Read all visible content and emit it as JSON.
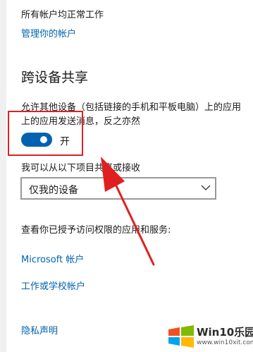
{
  "status": {
    "text": "所有帐户均正常工作",
    "manage_link": "管理你的帐户"
  },
  "cross_device": {
    "title": "跨设备共享",
    "description_line1": "允许其他设备（包括链接的手机和平板电脑）上的应用",
    "description_line2": "上的应用发送消息，反之亦然",
    "toggle_state": "on",
    "toggle_label": "开",
    "share_label": "我可以从以下项目共享或接收",
    "dropdown_value": "仅我的设备"
  },
  "access": {
    "text": "查看你已授予访问权限的应用和服务:",
    "microsoft_link": "Microsoft 帐户",
    "work_link": "工作或学校帐户"
  },
  "footer": {
    "privacy_link": "隐私声明"
  },
  "watermark": {
    "brand": "Win10乐园",
    "url": "www.win10xit.com"
  },
  "colors": {
    "accent": "#0063b1",
    "annotation_red": "#e02020"
  }
}
